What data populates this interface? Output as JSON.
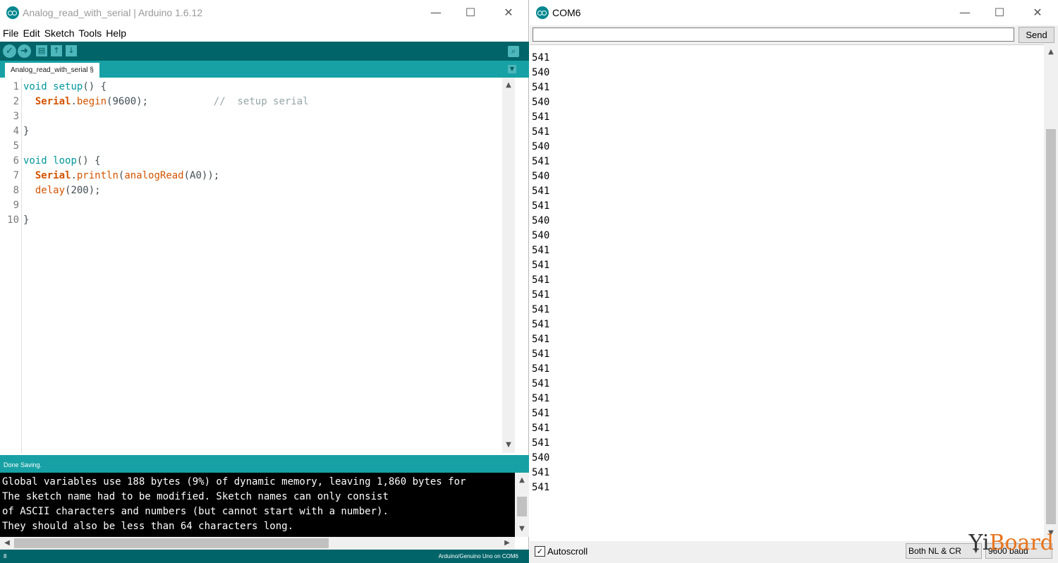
{
  "ide": {
    "title": "Analog_read_with_serial | Arduino 1.6.12",
    "window_controls": {
      "minimize": "—",
      "maximize": "☐",
      "close": "✕"
    },
    "menu": [
      "File",
      "Edit",
      "Sketch",
      "Tools",
      "Help"
    ],
    "toolbar": {
      "verify": "✓",
      "upload": "➜",
      "new": "▤",
      "open": "↑",
      "save": "↓",
      "serial_monitor": "⌕"
    },
    "tab_label": "Analog_read_with_serial §",
    "tab_menu": "▼",
    "line_numbers": [
      "1",
      "2",
      "3",
      "4",
      "5",
      "6",
      "7",
      "8",
      "9",
      "10"
    ],
    "code": {
      "l1": {
        "kw": "void",
        "fn": "setup",
        "rest": "() {"
      },
      "l2": {
        "indent": "  ",
        "cls": "Serial",
        "dot": ".",
        "fn": "begin",
        "args": "(9600);",
        "pad": "           ",
        "comment": "//  setup serial"
      },
      "l4": "}",
      "l6": {
        "kw": "void",
        "fn": "loop",
        "rest": "() {"
      },
      "l7": {
        "indent": "  ",
        "cls": "Serial",
        "dot": ".",
        "fn": "println",
        "open": "(",
        "fn2": "analogRead",
        "args": "(A0));"
      },
      "l8": {
        "indent": "  ",
        "fn": "delay",
        "args": "(200);"
      },
      "l10": "}"
    },
    "status": "Done Saving.",
    "console": [
      "Global variables use 188 bytes (9%) of dynamic memory, leaving 1,860 bytes for",
      "The sketch name had to be modified. Sketch names can only consist",
      "of ASCII characters and numbers (but cannot start with a number).",
      "They should also be less than 64 characters long."
    ],
    "footer_line": "8",
    "footer_board": "Arduino/Genuino Uno on COM6",
    "scroll_up": "▲",
    "scroll_down": "▼",
    "scroll_left": "◀",
    "scroll_right": "▶"
  },
  "monitor": {
    "title": "COM6",
    "input_value": "",
    "send_label": "Send",
    "output_lines": [
      "541",
      "540",
      "541",
      "540",
      "541",
      "541",
      "540",
      "541",
      "540",
      "541",
      "541",
      "540",
      "540",
      "541",
      "541",
      "541",
      "541",
      "541",
      "541",
      "541",
      "541",
      "541",
      "541",
      "541",
      "541",
      "541",
      "541",
      "540",
      "541",
      "541"
    ],
    "autoscroll_label": "Autoscroll",
    "autoscroll_checked": "✓",
    "line_ending": "Both NL & CR",
    "baud": "9600 baud",
    "dropdown_arrow": "▼"
  },
  "watermark": {
    "y": "Yi",
    "board": "Board"
  },
  "colors": {
    "teal_dark": "#006468",
    "teal": "#17a1a5",
    "keyword": "#00979c",
    "function": "#d35400",
    "comment": "#95a5a6"
  }
}
